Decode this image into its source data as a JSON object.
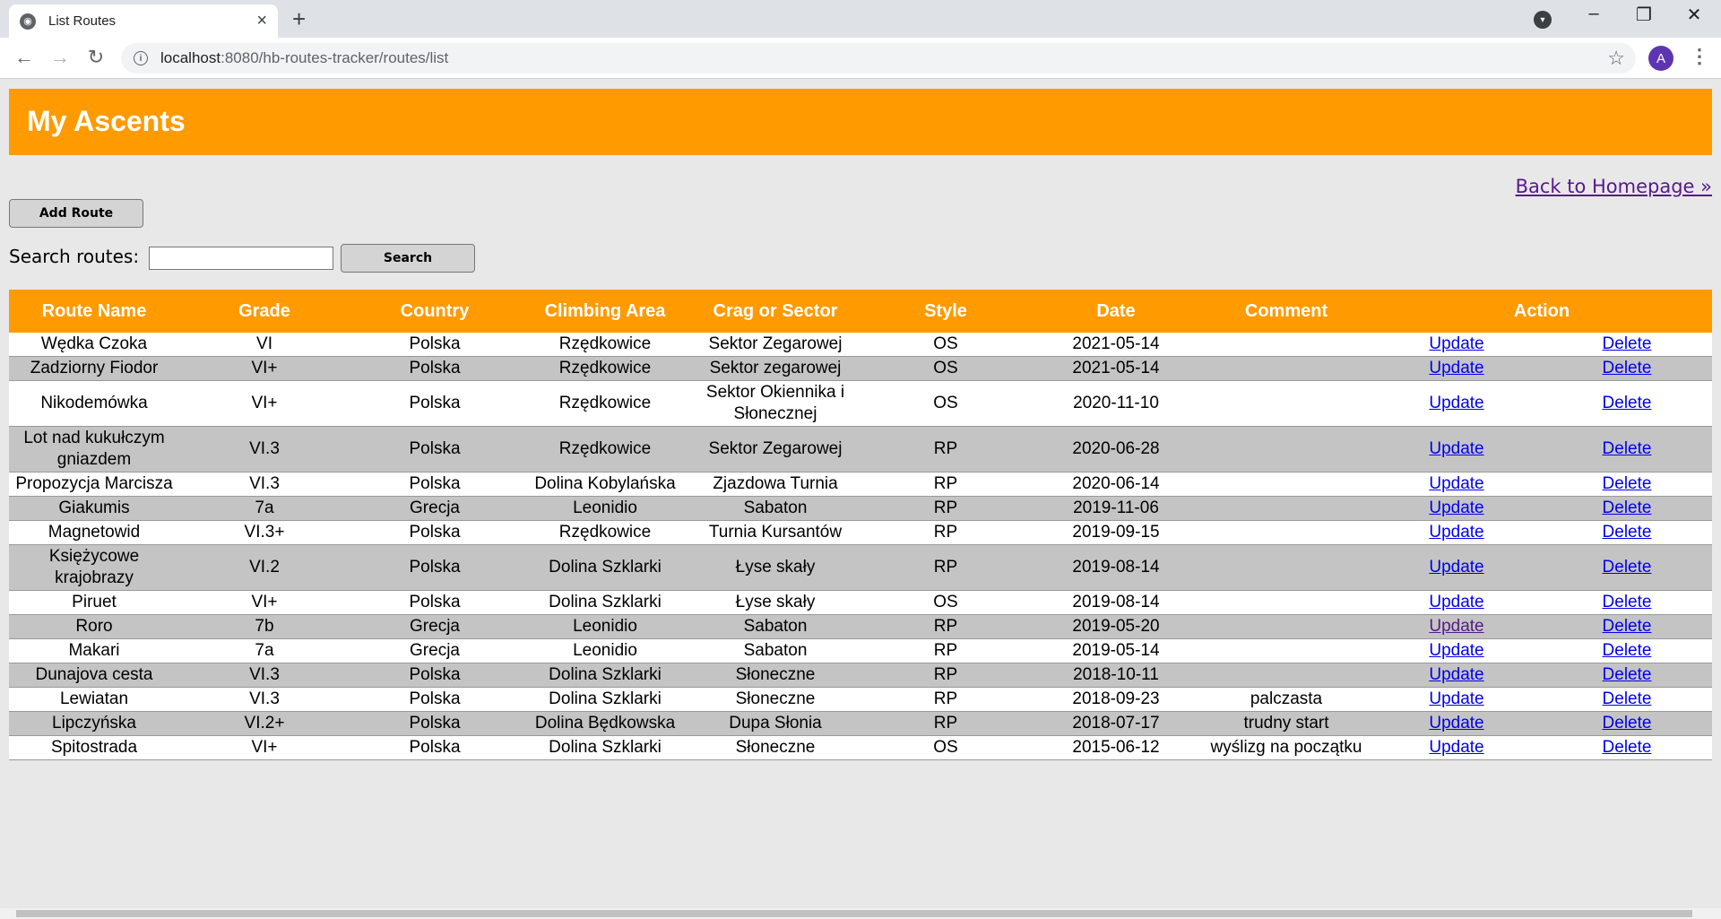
{
  "browser": {
    "tab_title": "List Routes",
    "url_host": "localhost",
    "url_rest": ":8080/hb-routes-tracker/routes/list",
    "avatar_letter": "A"
  },
  "page": {
    "title": "My Ascents",
    "back_link": "Back to Homepage »",
    "add_button": "Add Route",
    "search_label": "Search routes:",
    "search_value": "",
    "search_button": "Search"
  },
  "table": {
    "headers": [
      "Route Name",
      "Grade",
      "Country",
      "Climbing Area",
      "Crag or Sector",
      "Style",
      "Date",
      "Comment",
      "Action"
    ],
    "update_label": "Update",
    "delete_label": "Delete",
    "rows": [
      {
        "name": "Wędka Czoka",
        "grade": "VI",
        "country": "Polska",
        "area": "Rzędkowice",
        "crag": "Sektor Zegarowej",
        "style": "OS",
        "date": "2021-05-14",
        "comment": ""
      },
      {
        "name": "Zadziorny Fiodor",
        "grade": "VI+",
        "country": "Polska",
        "area": "Rzędkowice",
        "crag": "Sektor zegarowej",
        "style": "OS",
        "date": "2021-05-14",
        "comment": ""
      },
      {
        "name": "Nikodemówka",
        "grade": "VI+",
        "country": "Polska",
        "area": "Rzędkowice",
        "crag": "Sektor Okiennika i Słonecznej",
        "style": "OS",
        "date": "2020-11-10",
        "comment": ""
      },
      {
        "name": "Lot nad kukułczym gniazdem",
        "grade": "VI.3",
        "country": "Polska",
        "area": "Rzędkowice",
        "crag": "Sektor Zegarowej",
        "style": "RP",
        "date": "2020-06-28",
        "comment": ""
      },
      {
        "name": "Propozycja Marcisza",
        "grade": "VI.3",
        "country": "Polska",
        "area": "Dolina Kobylańska",
        "crag": "Zjazdowa Turnia",
        "style": "RP",
        "date": "2020-06-14",
        "comment": ""
      },
      {
        "name": "Giakumis",
        "grade": "7a",
        "country": "Grecja",
        "area": "Leonidio",
        "crag": "Sabaton",
        "style": "RP",
        "date": "2019-11-06",
        "comment": ""
      },
      {
        "name": "Magnetowid",
        "grade": "VI.3+",
        "country": "Polska",
        "area": "Rzędkowice",
        "crag": "Turnia Kursantów",
        "style": "RP",
        "date": "2019-09-15",
        "comment": ""
      },
      {
        "name": "Księżycowe krajobrazy",
        "grade": "VI.2",
        "country": "Polska",
        "area": "Dolina Szklarki",
        "crag": "Łyse skały",
        "style": "RP",
        "date": "2019-08-14",
        "comment": ""
      },
      {
        "name": "Piruet",
        "grade": "VI+",
        "country": "Polska",
        "area": "Dolina Szklarki",
        "crag": "Łyse skały",
        "style": "OS",
        "date": "2019-08-14",
        "comment": ""
      },
      {
        "name": "Roro",
        "grade": "7b",
        "country": "Grecja",
        "area": "Leonidio",
        "crag": "Sabaton",
        "style": "RP",
        "date": "2019-05-20",
        "comment": "",
        "update_visited": true
      },
      {
        "name": "Makari",
        "grade": "7a",
        "country": "Grecja",
        "area": "Leonidio",
        "crag": "Sabaton",
        "style": "RP",
        "date": "2019-05-14",
        "comment": ""
      },
      {
        "name": "Dunajova cesta",
        "grade": "VI.3",
        "country": "Polska",
        "area": "Dolina Szklarki",
        "crag": "Słoneczne",
        "style": "RP",
        "date": "2018-10-11",
        "comment": ""
      },
      {
        "name": "Lewiatan",
        "grade": "VI.3",
        "country": "Polska",
        "area": "Dolina Szklarki",
        "crag": "Słoneczne",
        "style": "RP",
        "date": "2018-09-23",
        "comment": "palczasta"
      },
      {
        "name": "Lipczyńska",
        "grade": "VI.2+",
        "country": "Polska",
        "area": "Dolina Będkowska",
        "crag": "Dupa Słonia",
        "style": "RP",
        "date": "2018-07-17",
        "comment": "trudny start"
      },
      {
        "name": "Spitostrada",
        "grade": "VI+",
        "country": "Polska",
        "area": "Dolina Szklarki",
        "crag": "Słoneczne",
        "style": "OS",
        "date": "2015-06-12",
        "comment": "wyślizg na początku"
      }
    ]
  },
  "colors": {
    "accent": "#ff9a00",
    "row_alt": "#c4c4c4",
    "link": "#0000ee",
    "visited": "#551a8b"
  }
}
